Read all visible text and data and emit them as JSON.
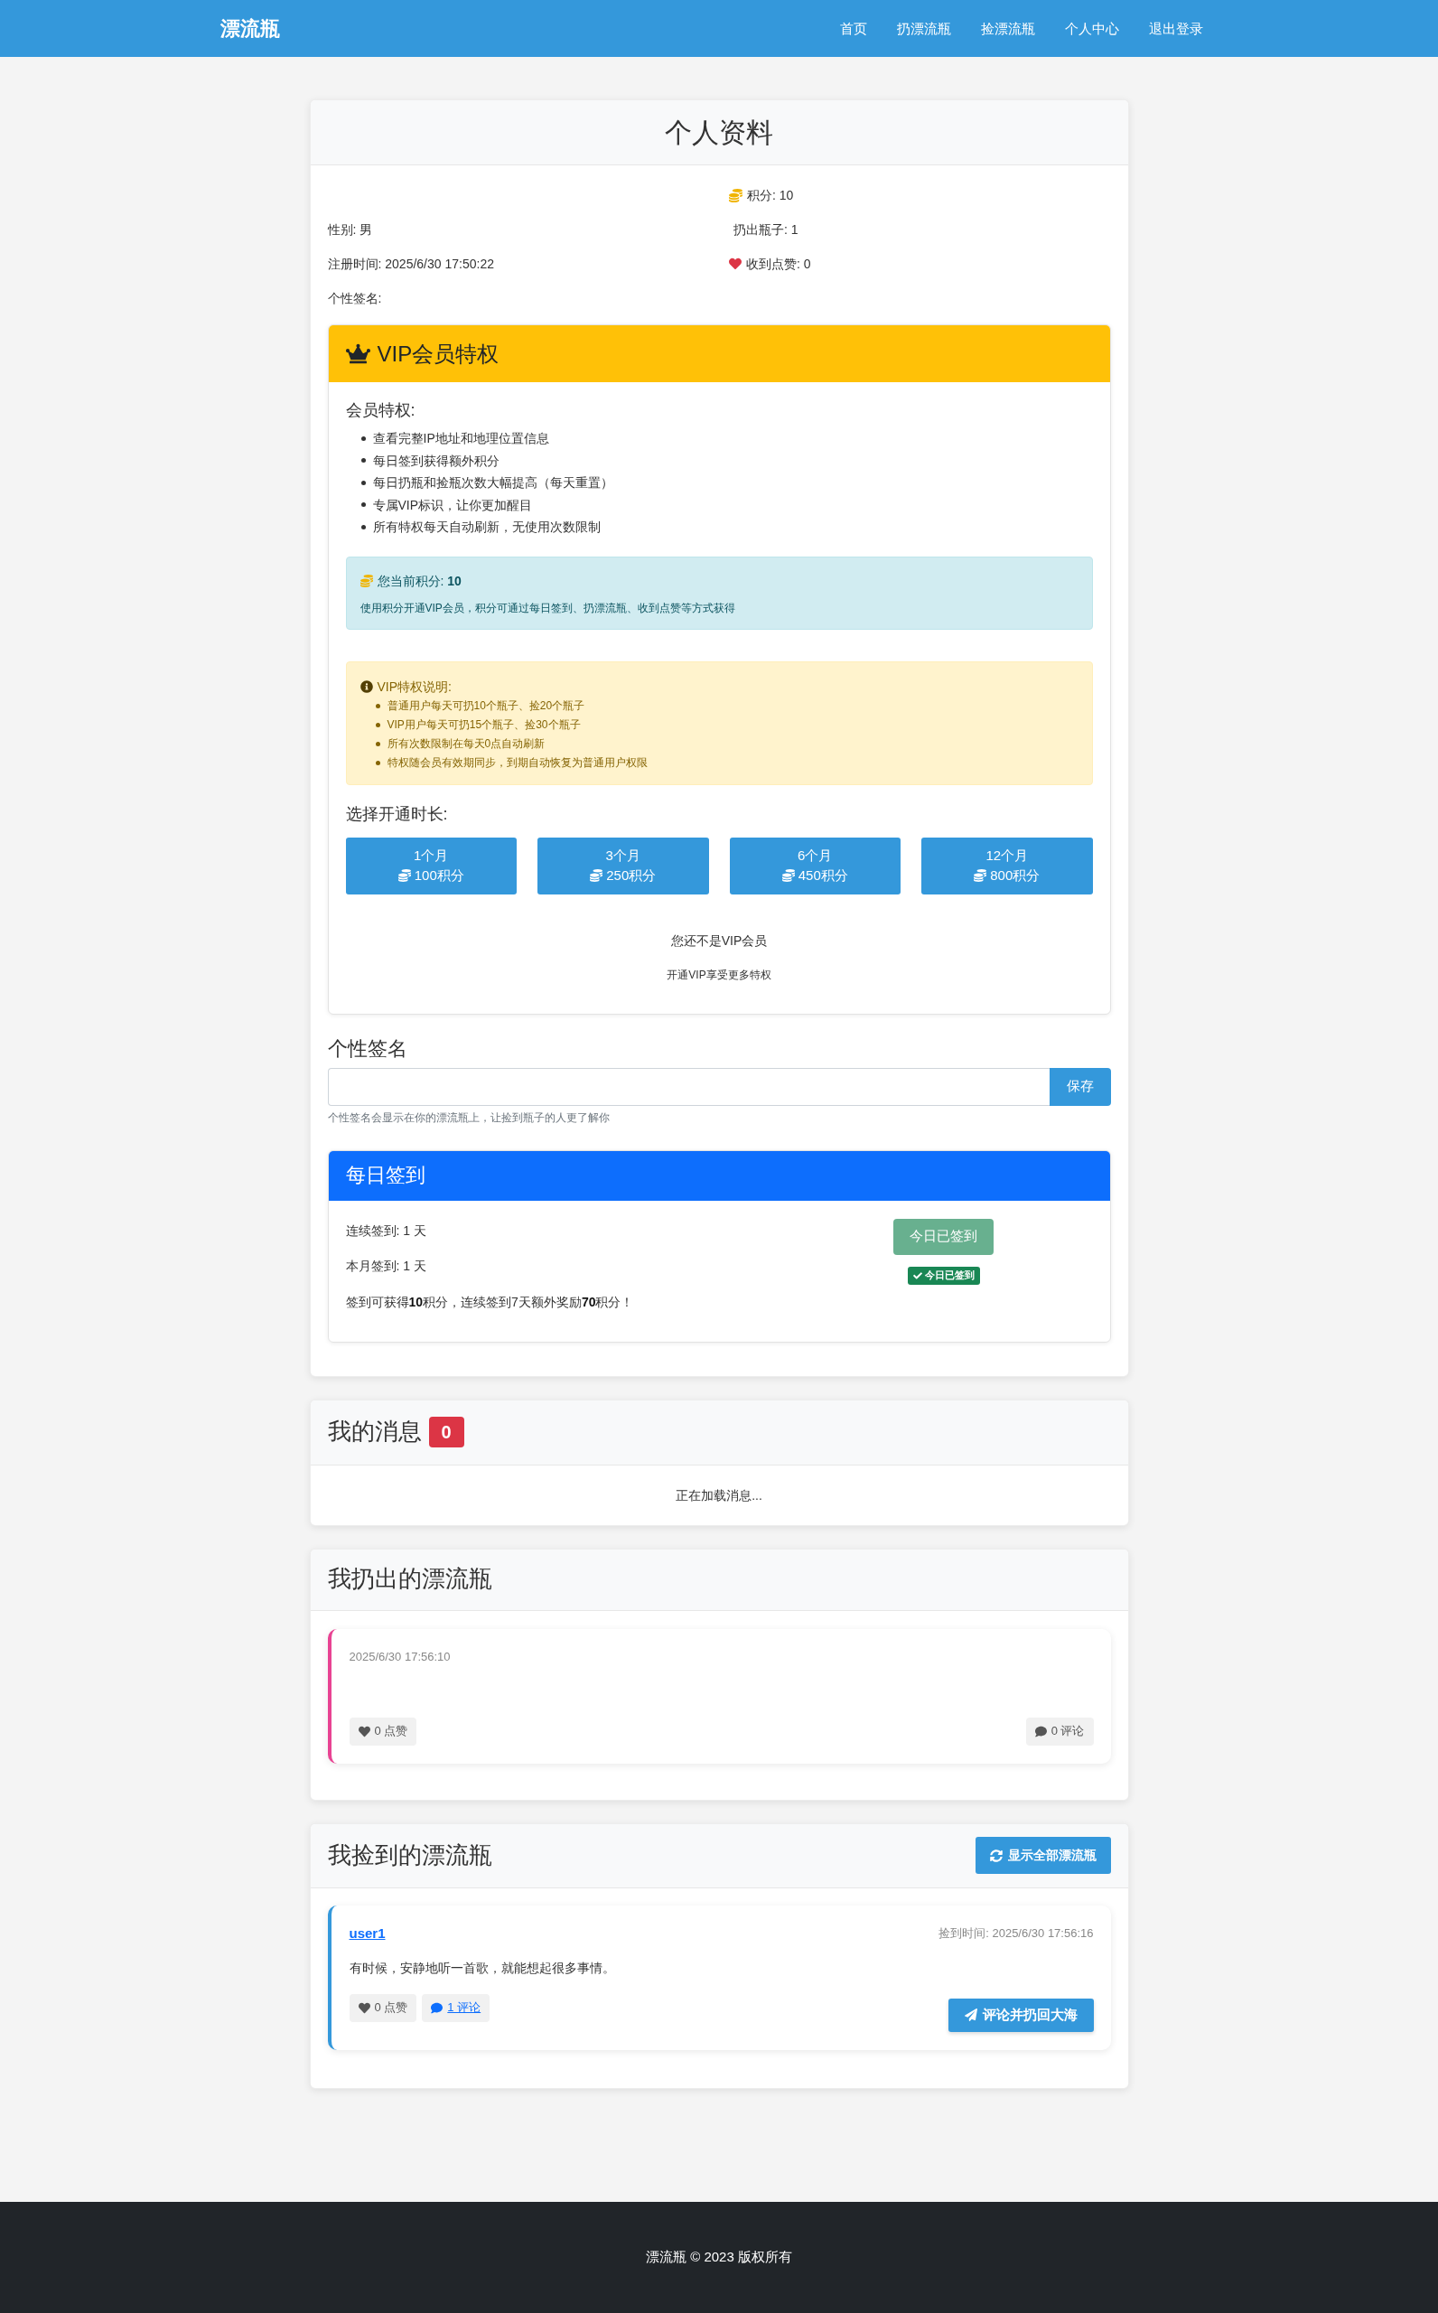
{
  "navbar": {
    "brand": "漂流瓶",
    "links": [
      "首页",
      "扔漂流瓶",
      "捡漂流瓶",
      "个人中心",
      "退出登录"
    ]
  },
  "profile": {
    "title": "个人资料",
    "details": [
      "性别: 男",
      "注册时间: 2025/6/30 17:50:22",
      "个性签名:"
    ],
    "stats": [
      {
        "kind": "points",
        "text": "积分: 10"
      },
      {
        "kind": "bottles",
        "text": "扔出瓶子: 1"
      },
      {
        "kind": "likes",
        "text": "收到点赞: 0"
      }
    ],
    "vip": {
      "title": "VIP会员特权",
      "benefits_heading": "会员特权:",
      "benefits": [
        "查看完整IP地址和地理位置信息",
        "每日签到获得额外积分",
        "每日扔瓶和捡瓶次数大幅提高（每天重置）",
        "专属VIP标识，让你更加醒目",
        "所有特权每天自动刷新，无使用次数限制"
      ],
      "points_alert": {
        "title": "您当前积分: **10**",
        "note": "使用积分开通VIP会员，积分可通过每日签到、扔漂流瓶、收到点赞等方式获得"
      },
      "rules": {
        "title": "VIP特权说明:",
        "items": [
          "普通用户每天可扔10个瓶子、捡20个瓶子",
          "VIP用户每天可扔15个瓶子、捡30个瓶子",
          "所有次数限制在每天0点自动刷新",
          "特权随会员有效期同步，到期自动恢复为普通用户权限"
        ]
      },
      "duration_heading": "选择开通时长:",
      "plans": [
        {
          "duration": "1个月",
          "price": "100积分"
        },
        {
          "duration": "3个月",
          "price": "250积分"
        },
        {
          "duration": "6个月",
          "price": "450积分"
        },
        {
          "duration": "12个月",
          "price": "800积分"
        }
      ],
      "status": "您还不是VIP会员",
      "status_hint": "开通VIP享受更多特权"
    },
    "signature": {
      "heading": "个性签名",
      "save_button": "保存",
      "hint": "个性签名会显示在你的漂流瓶上，让捡到瓶子的人更了解你"
    },
    "checkin": {
      "title": "每日签到",
      "stats": [
        "连续签到: 1 天",
        "本月签到: 1 天"
      ],
      "reward_note": "签到可获得**10**积分，连续签到7天额外奖励**70**积分！",
      "button": {
        "label": "今日已签到",
        "disabled": true
      },
      "status_badge": "今日已签到"
    }
  },
  "messages": {
    "title": "我的消息",
    "count": "0",
    "status": "正在加载消息..."
  },
  "thrown_bottles": {
    "title": "我扔出的漂流瓶",
    "bottles": [
      {
        "time": "2025/6/30 17:56:10",
        "likes": "0 点赞",
        "comments": "0 评论",
        "comments_link": false
      }
    ]
  },
  "picked_bottles": {
    "title": "我捡到的漂流瓶",
    "show_all_button": "显示全部漂流瓶",
    "bottles": [
      {
        "author": "user1",
        "picked_time": "捡到时间: 2025/6/30 17:56:16",
        "content": "有时候，安静地听一首歌，就能想起很多事情。",
        "likes": "0 点赞",
        "comments": "1 评论",
        "comments_link": true,
        "reply_button": "评论并扔回大海"
      }
    ]
  },
  "footer": {
    "text": "漂流瓶 © 2023 版权所有"
  }
}
